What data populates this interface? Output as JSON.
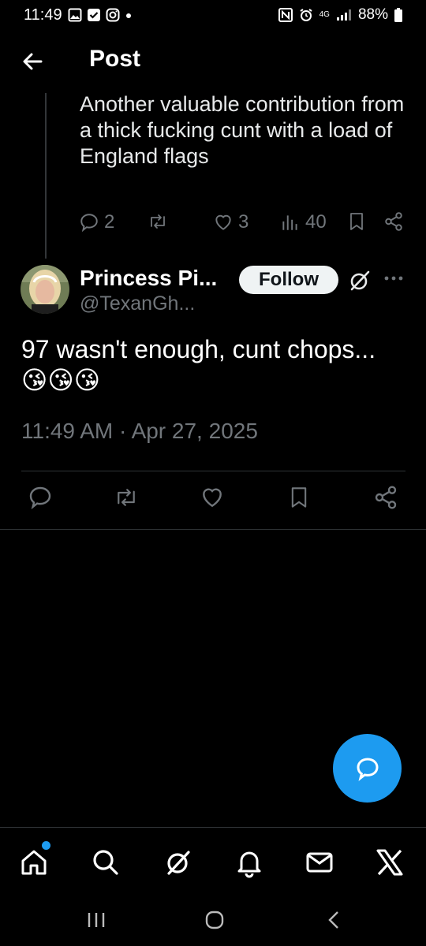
{
  "status_bar": {
    "time": "11:49",
    "left_icons": [
      "gallery-icon",
      "checkbox-icon",
      "instagram-icon",
      "dot-icon"
    ],
    "network": "4G",
    "battery": "88%"
  },
  "header": {
    "title": "Post",
    "back_icon": "arrow-left-icon"
  },
  "previous_tweet": {
    "text": "Another valuable contribution from a thick fucking cunt with a load of England flags",
    "replies": "2",
    "likes": "3",
    "views": "40"
  },
  "tweet": {
    "display_name": "Princess Pi...",
    "handle": "@TexanGh...",
    "follow_label": "Follow",
    "text": "97 wasn't enough, cunt chops...😘😘😘",
    "timestamp": "11:49 AM · Apr 27, 2025"
  },
  "colors": {
    "accent": "#1d9bf0",
    "muted": "#71767b",
    "background": "#000000"
  },
  "bottom_nav": [
    "home-icon",
    "search-icon",
    "grok-icon",
    "notifications-icon",
    "messages-icon",
    "x-logo-icon"
  ]
}
